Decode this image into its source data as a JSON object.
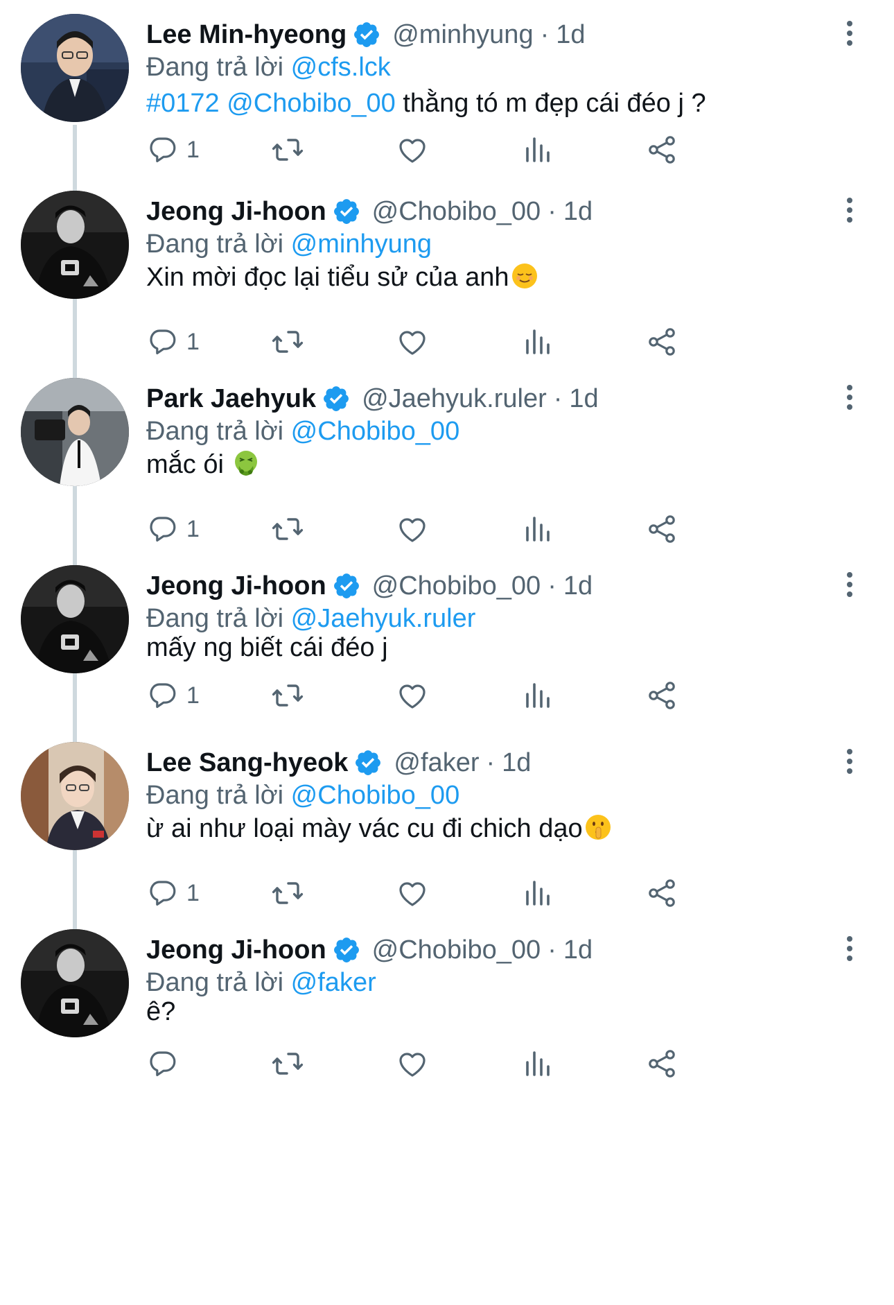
{
  "reply_prefix": "Đang trả lời",
  "colors": {
    "link": "#1d9bf0",
    "secondary": "#536471",
    "verified": "#1d9bf0",
    "thread_line": "#cfd9de"
  },
  "tweets": [
    {
      "name": "Lee Min-hyeong",
      "handle": "@minhyung",
      "time": "1d",
      "reply_to": "@cfs.lck",
      "tag": "#0172",
      "mention": "@Chobibo_00",
      "text": "thằng tó m đẹp cái đéo j ?",
      "reply_count": "1",
      "avatar_icon": "profile-photo"
    },
    {
      "name": "Jeong Ji-hoon",
      "handle": "@Chobibo_00",
      "time": "1d",
      "reply_to": "@minhyung",
      "text": "Xin mời đọc lại tiểu sử của anh",
      "emoji": "relieved-face-emoji",
      "reply_count": "1",
      "avatar_icon": "profile-photo"
    },
    {
      "name": "Park Jaehyuk",
      "handle": "@Jaehyuk.ruler",
      "time": "1d",
      "reply_to": "@Chobibo_00",
      "text": "mắc ói",
      "emoji": "vomiting-face-emoji",
      "reply_count": "1",
      "avatar_icon": "profile-photo"
    },
    {
      "name": "Jeong Ji-hoon",
      "handle": "@Chobibo_00",
      "time": "1d",
      "reply_to": "@Jaehyuk.ruler",
      "text": "mấy ng biết cái đéo j",
      "reply_count": "1",
      "avatar_icon": "profile-photo"
    },
    {
      "name": "Lee Sang-hyeok",
      "handle": "@faker",
      "time": "1d",
      "reply_to": "@Chobibo_00",
      "text": "ừ ai như loại mày vác cu đi chich dạo",
      "emoji": "shushing-face-emoji",
      "reply_count": "1",
      "avatar_icon": "profile-photo"
    },
    {
      "name": "Jeong Ji-hoon",
      "handle": "@Chobibo_00",
      "time": "1d",
      "reply_to": "@faker",
      "text": "ê?",
      "reply_count": "",
      "avatar_icon": "profile-photo"
    }
  ],
  "action_icons": [
    "reply-icon",
    "retweet-icon",
    "like-icon",
    "views-icon",
    "share-icon"
  ]
}
